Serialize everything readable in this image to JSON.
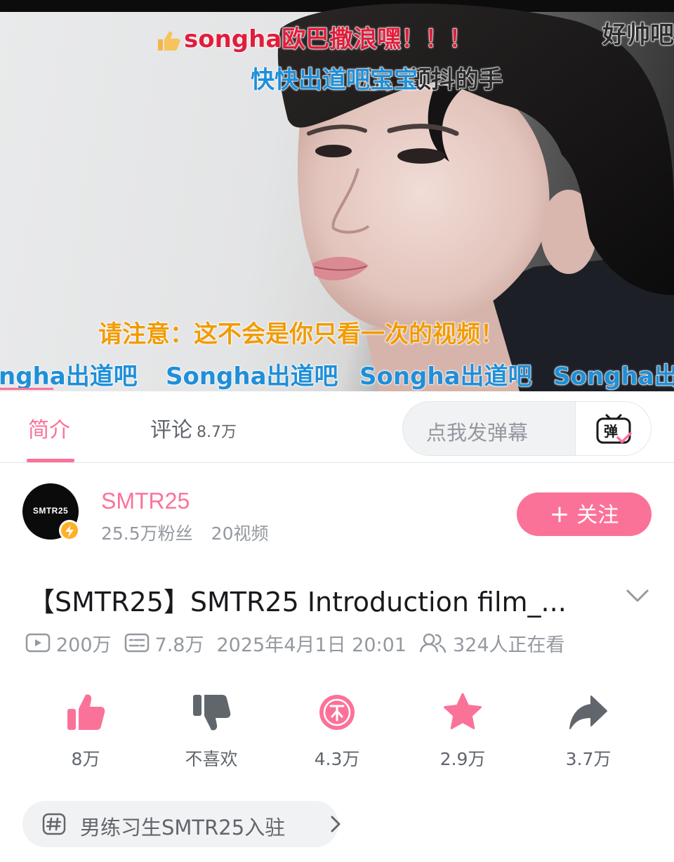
{
  "danmaku": {
    "line1": "songha欧巴撒浪嘿！！！",
    "line1_right": "好帅吧",
    "line2_blue": "快快出道吧宝宝",
    "line2_dark": "心，颤抖的手",
    "notice": "请注意：这不会是你只看一次的视频！",
    "scroll": [
      "ngha出道吧",
      "Songha出道吧",
      "Songha出道吧",
      "Songha出"
    ]
  },
  "tabs": {
    "intro": "简介",
    "comments": "评论",
    "comments_count": "8.7万"
  },
  "danmaku_input": {
    "placeholder": "点我发弹幕",
    "button_label": "弹"
  },
  "uploader": {
    "avatar_text": "SMTR25",
    "name": "SMTR25",
    "fans": "25.5万粉丝",
    "videos": "20视频",
    "follow_label": "关注",
    "follow_plus": "+"
  },
  "video": {
    "title": "【SMTR25】SMTR25 Introduction film_...",
    "views": "200万",
    "danmaku_count": "7.8万",
    "publish_time": "2025年4月1日 20:01",
    "watching": "324人正在看"
  },
  "actions": [
    {
      "name": "like",
      "label": "8万"
    },
    {
      "name": "dislike",
      "label": "不喜欢"
    },
    {
      "name": "coin",
      "label": "4.3万"
    },
    {
      "name": "favorite",
      "label": "2.9万"
    },
    {
      "name": "share",
      "label": "3.7万"
    }
  ],
  "tag": {
    "label": "男练习生SMTR25入驻"
  },
  "colors": {
    "accent": "#fb7299",
    "secondary_text": "#9499a0",
    "icon_gray": "#61666d"
  }
}
